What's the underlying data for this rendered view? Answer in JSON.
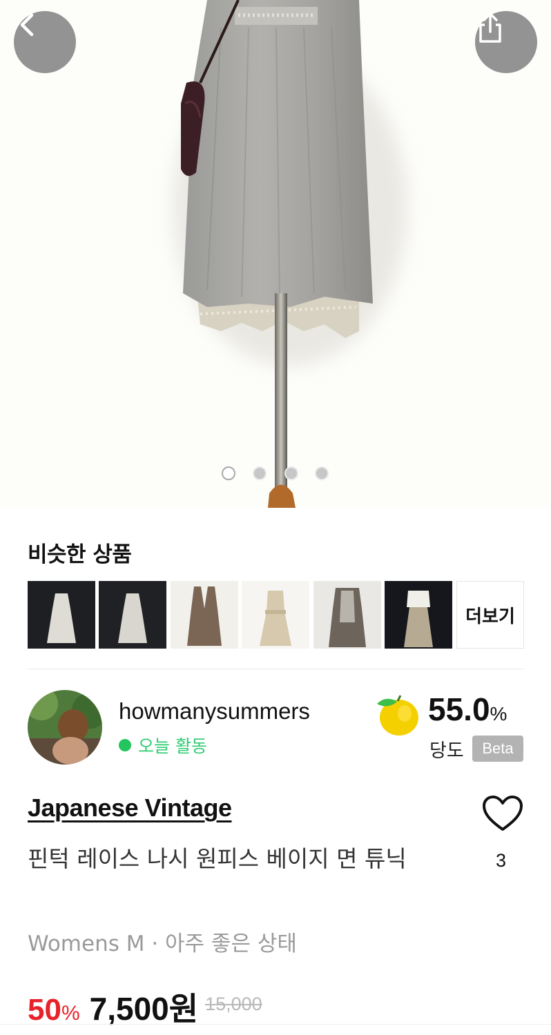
{
  "hero": {
    "image_alt": "lace pintuck sleeveless dress on mannequin",
    "back_icon": "chevron-left-icon",
    "share_icon": "share-icon",
    "slide_count": 4,
    "active_slide": 1
  },
  "similar": {
    "title": "비슷한 상품",
    "more_label": "더보기",
    "thumbnails": [
      "white-dress-dark-bg",
      "white-dress-dark-bg",
      "brown-vest-dress",
      "beige-dress",
      "brown-layered-dress",
      "white-top-long-skirt"
    ]
  },
  "seller": {
    "name": "howmanysummers",
    "activity": "오늘 활동",
    "sweetness_value": "55.0",
    "sweetness_unit": "%",
    "sweetness_label": "당도",
    "beta_label": "Beta"
  },
  "product": {
    "brand": "Japanese Vintage",
    "title": "핀턱 레이스 나시 원피스 베이지 면 튜닉",
    "condition": "Womens M · 아주 좋은 상태",
    "like_count": "3",
    "discount_value": "50",
    "discount_unit": "%",
    "price": "7,500원",
    "original_price": "15,000"
  },
  "colors": {
    "accent_red": "#e8222b",
    "active_green": "#22c55e",
    "beta_gray": "#b3b3b3"
  }
}
